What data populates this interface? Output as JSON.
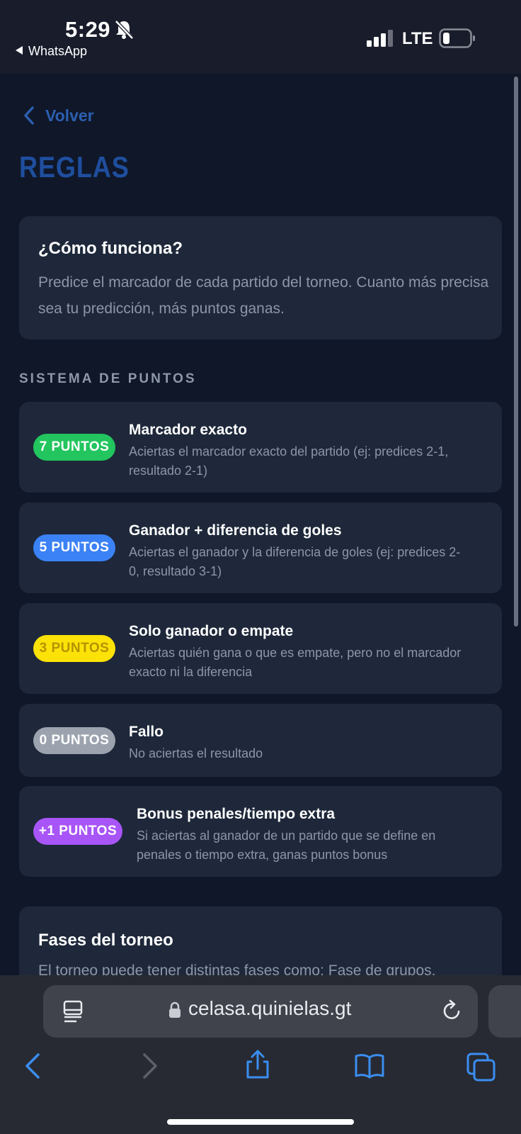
{
  "status_bar": {
    "time": "5:29",
    "back_app": "WhatsApp",
    "network": "LTE"
  },
  "page": {
    "back_label": "Volver",
    "title": "REGLAS"
  },
  "how_it_works": {
    "title": "¿Cómo funciona?",
    "text": "Predice el marcador de cada partido del torneo. Cuanto más precisa sea tu predicción, más puntos ganas."
  },
  "points_system": {
    "section_title": "SISTEMA DE PUNTOS",
    "rules": [
      {
        "badge": "7 PUNTOS",
        "badge_color": "#22c55e",
        "badge_text_color": "#ffffff",
        "title": "Marcador exacto",
        "desc_lines": [
          "Aciertas el marcador exacto del partido (ej: predices 2-1,",
          "resultado 2-1)"
        ]
      },
      {
        "badge": "5 PUNTOS",
        "badge_color": "#3b82f6",
        "badge_text_color": "#ffffff",
        "title": "Ganador + diferencia de goles",
        "desc_lines": [
          "Aciertas el ganador y la diferencia de goles (ej: predices 2-",
          "0, resultado 3-1)"
        ]
      },
      {
        "badge": "3 PUNTOS",
        "badge_color": "#fde208",
        "badge_text_color": "#b49300",
        "title": "Solo ganador o empate",
        "desc_lines": [
          "Aciertas quién gana o que es empate, pero no el marcador",
          "exacto ni la diferencia"
        ]
      },
      {
        "badge": "0 PUNTOS",
        "badge_color": "#9ca3af",
        "badge_text_color": "#ffffff",
        "title": "Fallo",
        "desc_lines": [
          "No aciertas el resultado"
        ]
      },
      {
        "badge": "+1 PUNTOS",
        "badge_color": "#a855f7",
        "badge_text_color": "#ffffff",
        "title": "Bonus penales/tiempo extra",
        "desc_lines": [
          "Si aciertas al ganador de un partido que se define en",
          "penales o tiempo extra, ganas puntos bonus"
        ]
      }
    ]
  },
  "phases": {
    "title": "Fases del torneo",
    "text": "El torneo puede tener distintas fases como: Fase de grupos,"
  },
  "browser": {
    "url": "celasa.quinielas.gt"
  }
}
